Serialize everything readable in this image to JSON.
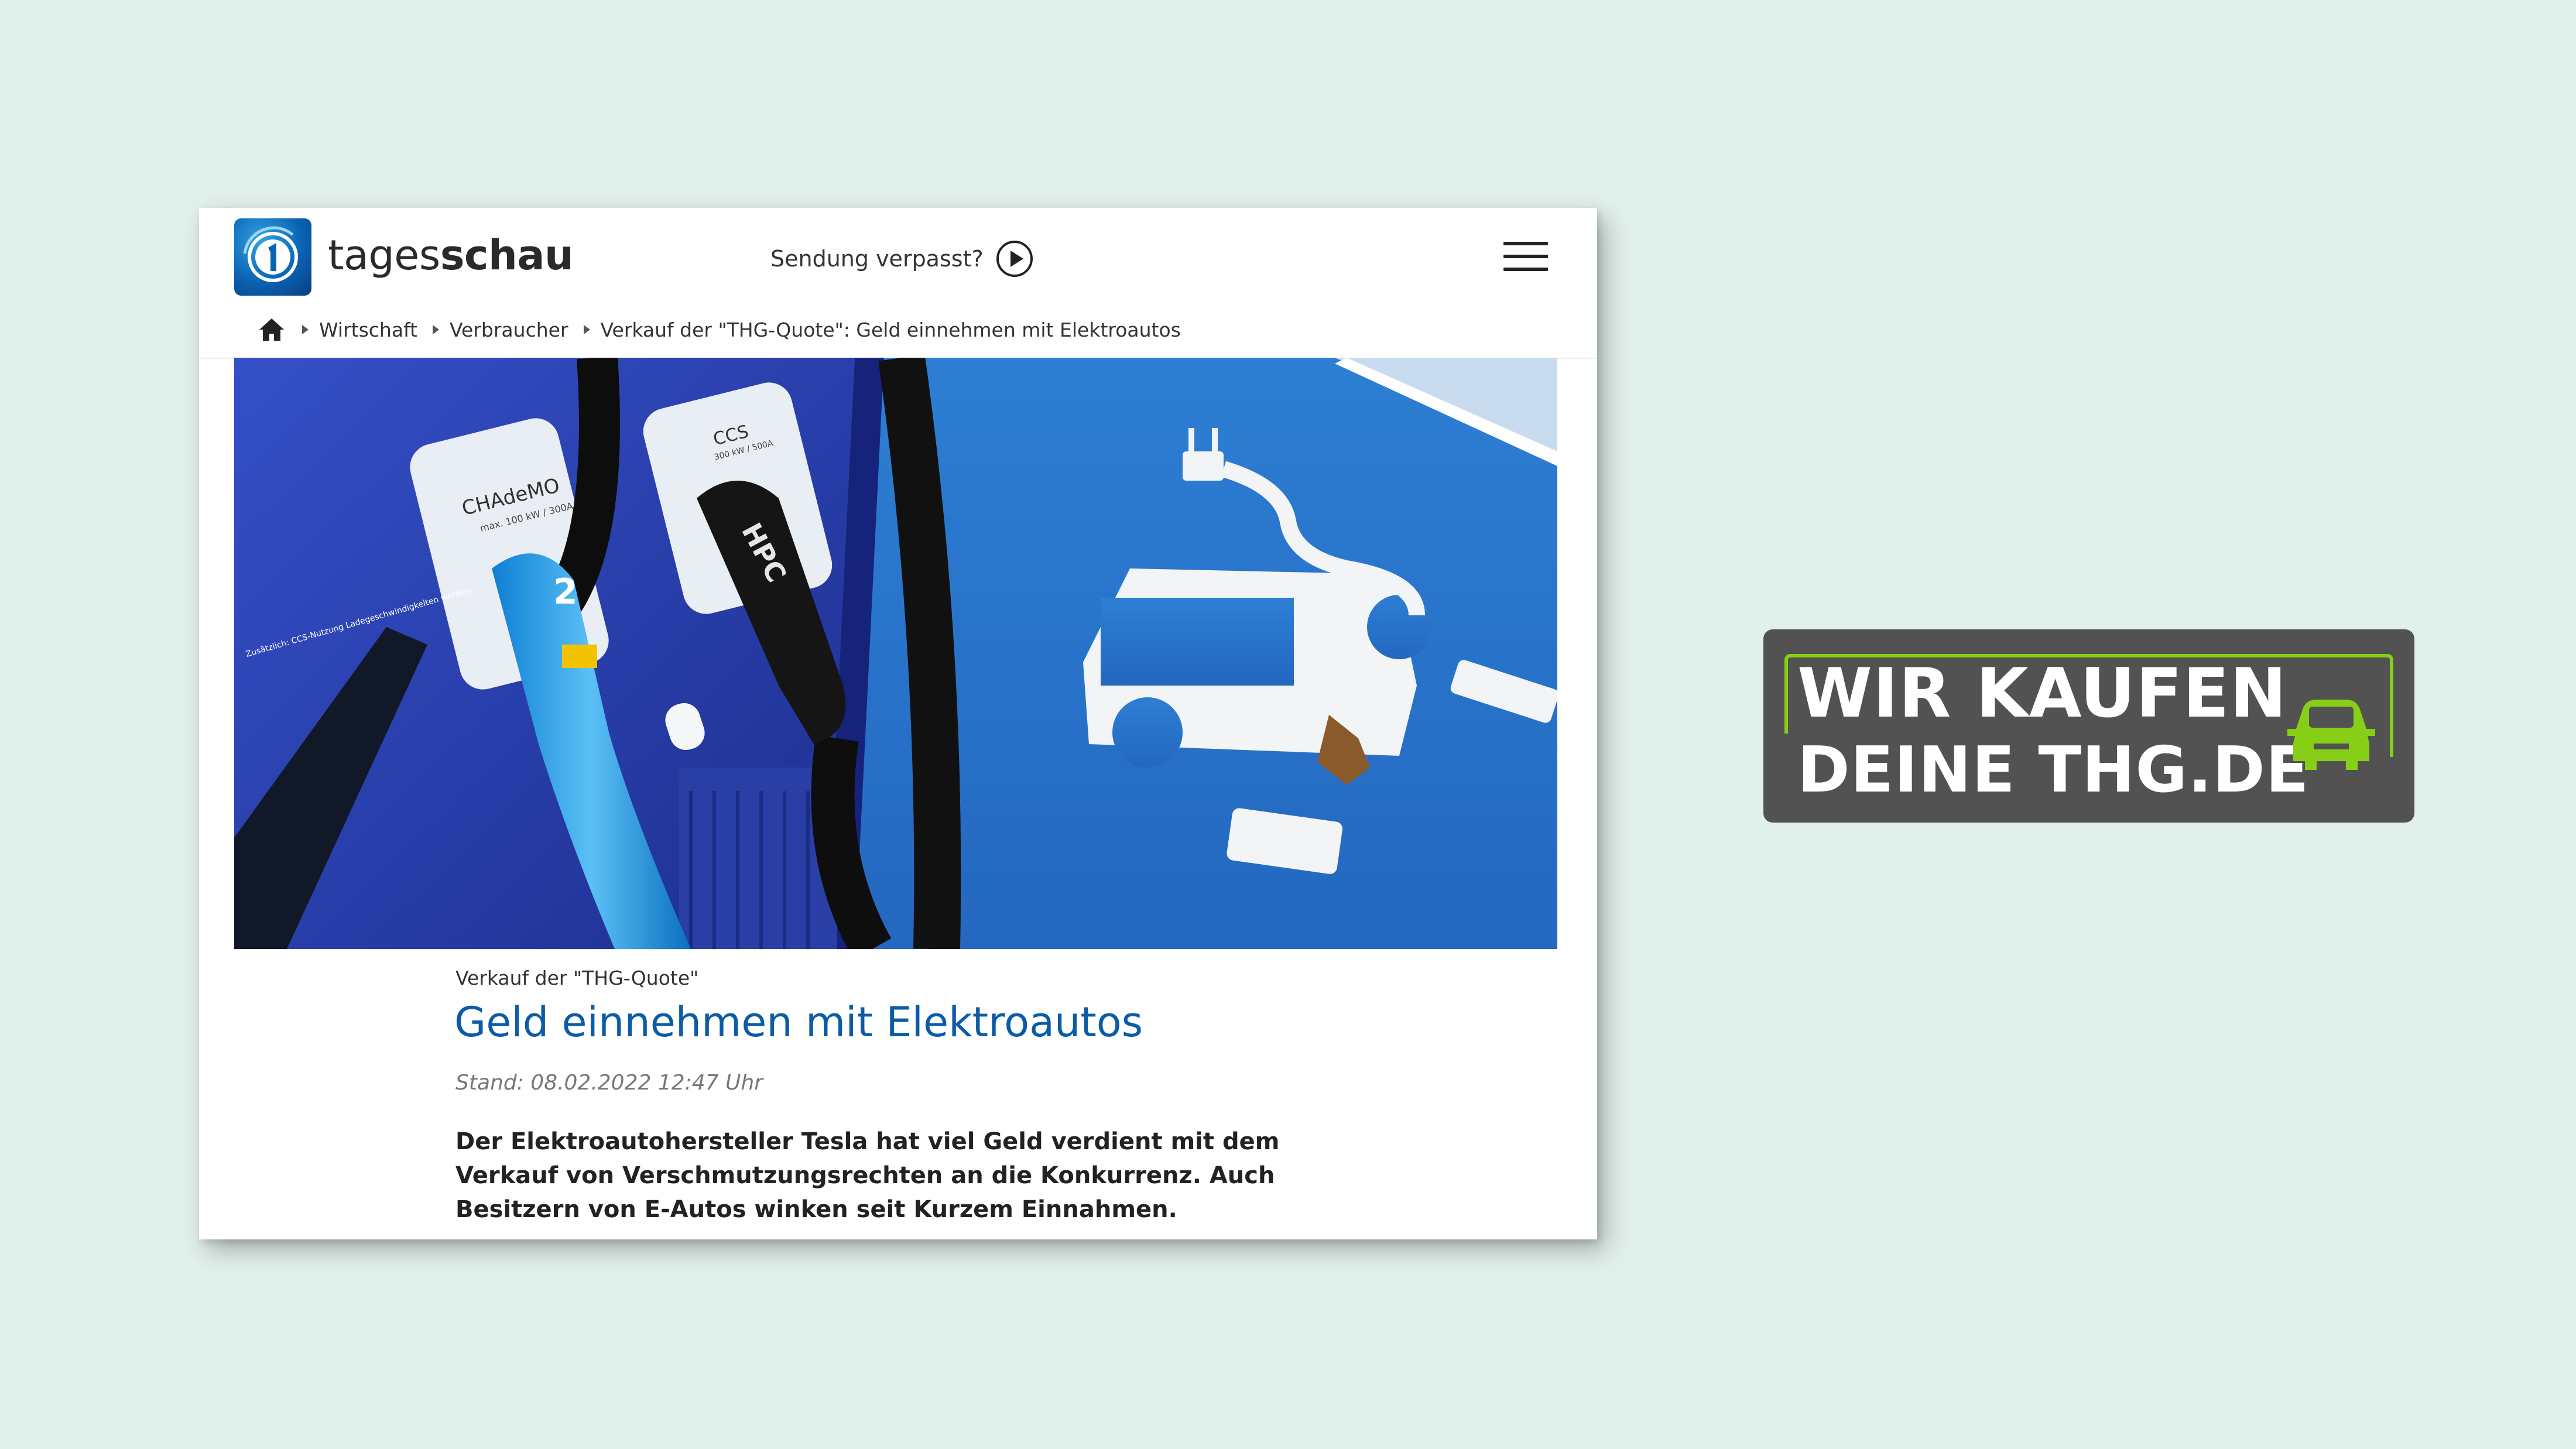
{
  "site": {
    "brand_light": "tages",
    "brand_bold": "schau",
    "missed_label": "Sendung verpasst?"
  },
  "breadcrumb": {
    "items": [
      "Wirtschaft",
      "Verbraucher",
      "Verkauf der \"THG-Quote\": Geld einnehmen mit Elektroautos"
    ]
  },
  "article": {
    "kicker": "Verkauf der \"THG-Quote\"",
    "headline": "Geld einnehmen mit Elektroautos",
    "timestamp": "Stand: 08.02.2022 12:47 Uhr",
    "lead": "Der Elektroautohersteller Tesla hat viel Geld verdient mit dem Verkauf von Verschmutzungsrechten an die Konkurrenz. Auch Besitzern von E-Autos winken seit Kurzem Einnahmen."
  },
  "photo": {
    "charger_labels": [
      "CHAdeMO",
      "max. 100 kW / 300A",
      "CCS",
      "300 kW / 500A",
      "2",
      "HPC"
    ],
    "side_note": "Zusätzlich: CCS-Nutzung Ladegeschwindigkeiten werden."
  },
  "promo": {
    "line1": "WIR KAUFEN",
    "line2": "DEINE THG.DE"
  },
  "icons": {
    "logo": "ard-one-logo-icon",
    "play": "play-circle-icon",
    "menu": "hamburger-menu-icon",
    "home": "home-icon",
    "car": "car-icon"
  },
  "colors": {
    "background": "#e2f0ec",
    "headline": "#0b5ba7",
    "promo_bg": "#525252",
    "promo_accent": "#87cf17",
    "charger_blue": "#2a41b8",
    "parking_blue": "#2c7bd0"
  }
}
